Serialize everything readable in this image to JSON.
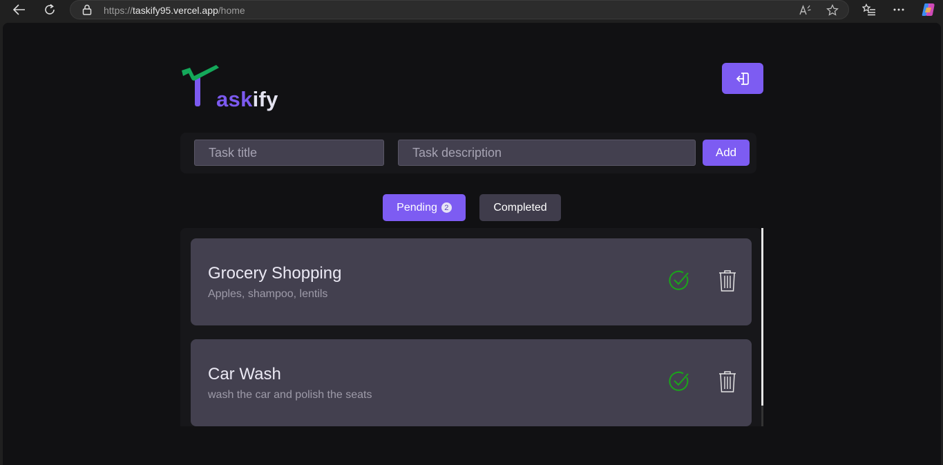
{
  "browser": {
    "url_prefix": "https://",
    "url_host": "taskify95.vercel.app",
    "url_path": "/home",
    "icons": [
      "back-icon",
      "refresh-icon",
      "lock-icon",
      "read-aloud-icon",
      "favorite-star-icon",
      "favorites-list-icon",
      "more-icon",
      "copilot-icon"
    ]
  },
  "app": {
    "logo_ask": "ask",
    "logo_ify": "ify",
    "logout_icon": "logout-icon",
    "accent_color": "#7d5cf2",
    "logo_check_color": "#14a85a",
    "check_color": "#1aa51a"
  },
  "form": {
    "title_placeholder": "Task title",
    "description_placeholder": "Task description",
    "add_label": "Add"
  },
  "tabs": {
    "pending_label": "Pending",
    "pending_count": "2",
    "completed_label": "Completed"
  },
  "tasks": [
    {
      "title": "Grocery Shopping",
      "description": "Apples, shampoo, lentils"
    },
    {
      "title": "Car Wash",
      "description": "wash the car and polish the seats"
    }
  ]
}
